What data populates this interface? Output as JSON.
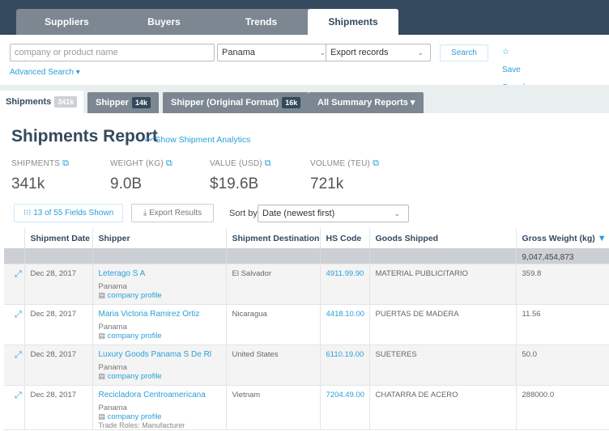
{
  "top_tabs": [
    {
      "label": "Suppliers"
    },
    {
      "label": "Buyers"
    },
    {
      "label": "Trends"
    },
    {
      "label": "Shipments",
      "active": true
    }
  ],
  "search": {
    "placeholder": "company or product name",
    "value": "",
    "country": "Panama",
    "record_type": "Export records",
    "search_label": "Search",
    "save_search_label": "Save Search",
    "advanced_label": "Advanced Search ▾"
  },
  "sub_tabs": [
    {
      "label": "Shipments",
      "count": "341k",
      "active": true
    },
    {
      "label": "Shipper",
      "count": "14k"
    },
    {
      "label": "Shipper (Original Format)",
      "count": "16k"
    },
    {
      "label": "All Summary Reports ▾",
      "count": null
    }
  ],
  "report": {
    "title": "Shipments Report",
    "analytics_link": "Show Shipment Analytics"
  },
  "stats": [
    {
      "label": "SHIPMENTS",
      "value": "341k"
    },
    {
      "label": "WEIGHT (KG)",
      "value": "9.0B"
    },
    {
      "label": "VALUE (USD)",
      "value": "$19.6B"
    },
    {
      "label": "VOLUME (TEU)",
      "value": "721k"
    }
  ],
  "controls": {
    "fields_label": "13 of 55 Fields Shown",
    "export_label": "Export Results",
    "sort_label": "Sort by",
    "sort_value": "Date (newest first)"
  },
  "table": {
    "headers": [
      "",
      "Shipment Date",
      "Shipper",
      "Shipment Destination",
      "HS Code",
      "Goods Shipped",
      "Gross Weight (kg)"
    ],
    "total_gross_weight": "9,047,454,873",
    "rows": [
      {
        "date": "Dec 28, 2017",
        "shipper": "Leterago S A",
        "country": "Panama",
        "profile": "company profile",
        "roles": "",
        "destination": "El Salvador",
        "hs_code": "4911.99.90",
        "goods": "MATERIAL PUBLICITARIO",
        "weight": "359.8"
      },
      {
        "date": "Dec 28, 2017",
        "shipper": "Maria Victoria Ramirez Ortiz",
        "country": "Panama",
        "profile": "company profile",
        "roles": "",
        "destination": "Nicaragua",
        "hs_code": "4418.10.00",
        "goods": "PUERTAS DE MADERA",
        "weight": "11.56"
      },
      {
        "date": "Dec 28, 2017",
        "shipper": "Luxury Goods Panama S De Rl",
        "country": "Panama",
        "profile": "company profile",
        "roles": "",
        "destination": "United States",
        "hs_code": "6110.19.00",
        "goods": "SUETERES",
        "weight": "50.0"
      },
      {
        "date": "Dec 28, 2017",
        "shipper": "Recicladora Centroamericana",
        "country": "Panama",
        "profile": "company profile",
        "roles": "Trade Roles: Manufacturer",
        "destination": "Vietnam",
        "hs_code": "7204.49.00",
        "goods": "CHATARRA DE ACERO",
        "weight": "288000.0"
      }
    ]
  },
  "colors": {
    "nav_bg": "#34495e",
    "inactive_tab": "#7c8791",
    "accent": "#2a9fd8",
    "total_row": "#ccd0d4"
  }
}
